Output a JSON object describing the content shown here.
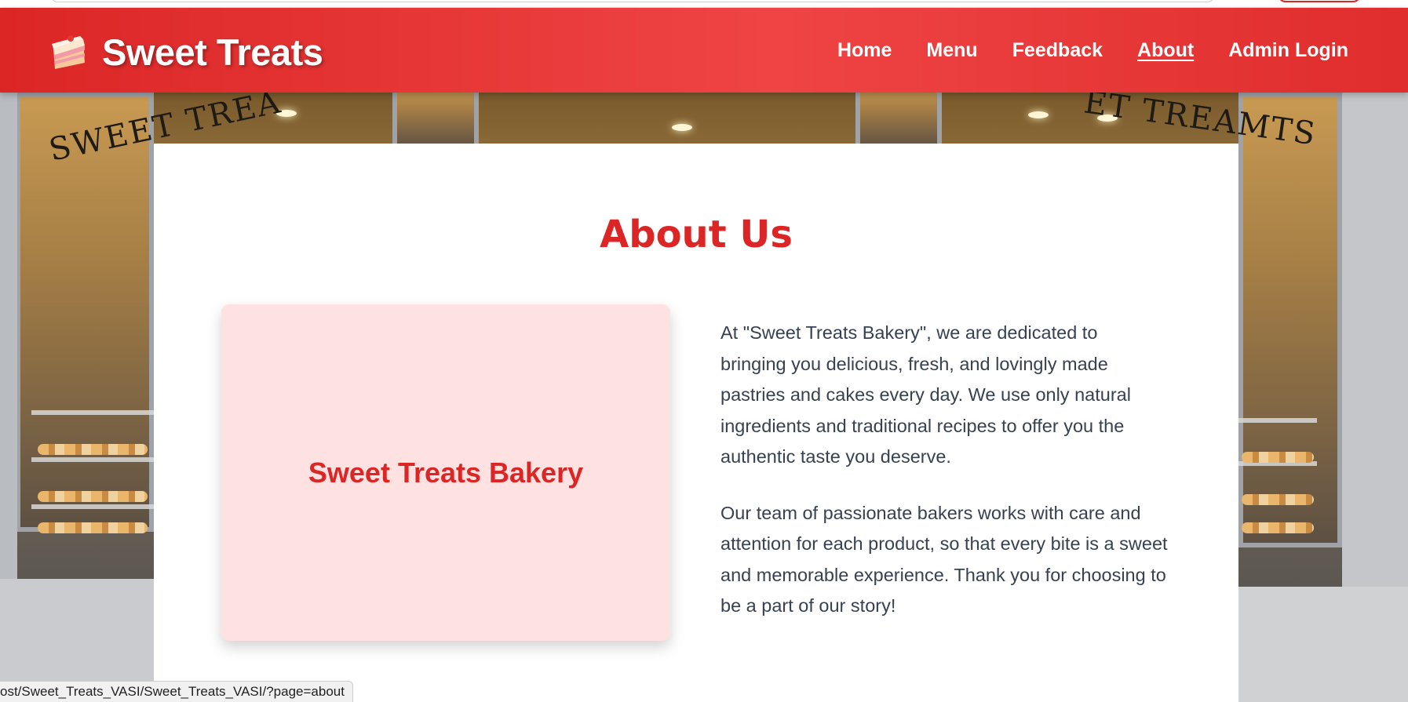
{
  "header": {
    "brand_name": "Sweet Treats",
    "brand_icon": "cake-slice-icon",
    "nav": [
      {
        "label": "Home",
        "active": false
      },
      {
        "label": "Menu",
        "active": false
      },
      {
        "label": "Feedback",
        "active": false
      },
      {
        "label": "About",
        "active": true
      },
      {
        "label": "Admin Login",
        "active": false
      }
    ]
  },
  "background": {
    "sign_left": "SWEET TREA",
    "sign_right": "ET TREAMTS"
  },
  "about": {
    "title": "About Us",
    "image_label": "Sweet Treats Bakery",
    "paragraphs": [
      "At \"Sweet Treats Bakery\", we are dedicated to bringing you delicious, fresh, and lovingly made pastries and cakes every day. We use only natural ingredients and traditional recipes to offer you the authentic taste you deserve.",
      "Our team of passionate bakers works with care and attention for each product, so that every bite is a sweet and memorable experience. Thank you for choosing to be a part of our story!"
    ]
  },
  "status_bar": {
    "url": "ost/Sweet_Treats_VASI/Sweet_Treats_VASI/?page=about"
  },
  "colors": {
    "accent": "#dc2626",
    "image_box_bg": "#fee2e2",
    "body_text": "#374151"
  }
}
